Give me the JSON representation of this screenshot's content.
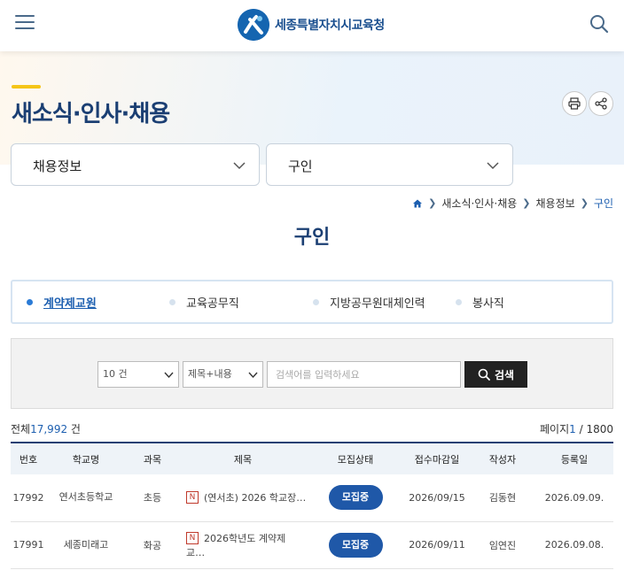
{
  "header": {
    "logo_text": "세종특별자치시교육청"
  },
  "hero": {
    "title": "새소식·인사·채용"
  },
  "selects": {
    "category": "채용정보",
    "subcategory": "구인"
  },
  "breadcrumb": [
    "새소식·인사·채용",
    "채용정보",
    "구인"
  ],
  "subtitle": "구인",
  "tabs": [
    {
      "label": "계약제교원",
      "active": true
    },
    {
      "label": "교육공무직",
      "active": false
    },
    {
      "label": "지방공무원대체인력",
      "active": false
    },
    {
      "label": "봉사직",
      "active": false
    }
  ],
  "search": {
    "page_size": "10 건",
    "field": "제목+내용",
    "placeholder": "검색어를 입력하세요",
    "button": "검색"
  },
  "summary": {
    "total_prefix": "전체",
    "total_count": "17,992",
    "total_suffix": "건",
    "page_prefix": "페이지",
    "page_current": "1",
    "page_total": "/ 1800"
  },
  "table": {
    "headers": [
      "번호",
      "학교명",
      "과목",
      "제목",
      "모집상태",
      "접수마감일",
      "작성자",
      "등록일"
    ],
    "rows": [
      {
        "no": "17992",
        "school": "연서초등학교",
        "subject": "초등",
        "badge": "N",
        "title": "(연서초) 2026 학교장…",
        "status": "모집중",
        "deadline": "2026/09/15",
        "author": "김동현",
        "date": "2026.09.09."
      },
      {
        "no": "17991",
        "school": "세종미래고",
        "subject": "화공",
        "badge": "N",
        "title": "2026학년도 계약제 교…",
        "status": "모집중",
        "deadline": "2026/09/11",
        "author": "임연진",
        "date": "2026.09.08."
      }
    ]
  },
  "colors": {
    "brand": "#1b3f73",
    "accent": "#f5c518",
    "link": "#1d5fb0",
    "status": "#1f58a8"
  }
}
